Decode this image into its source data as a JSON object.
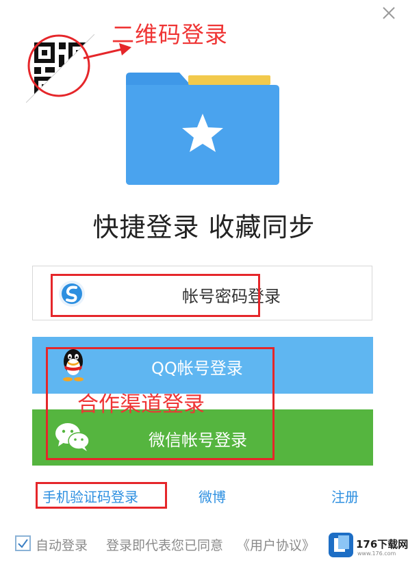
{
  "annotations": {
    "qr_login": "二维码登录",
    "partner_login": "合作渠道登录"
  },
  "slogan": "快捷登录 收藏同步",
  "buttons": {
    "account_login": "帐号密码登录",
    "qq_login": "QQ帐号登录",
    "wechat_login": "微信帐号登录"
  },
  "links": {
    "phone_login": "手机验证码登录",
    "weibo": "微博",
    "register": "注册"
  },
  "footer": {
    "auto_login": "自动登录",
    "agree_text": "登录即代表您已同意",
    "user_agreement": "《用户协议》",
    "auto_login_checked": true
  },
  "watermark": {
    "brand": "176下载网",
    "url": "www.176.com"
  },
  "colors": {
    "accent_blue": "#5fb6f1",
    "wechat_green": "#55b53f",
    "link_blue": "#2d8fe0",
    "annotation_red": "#e5262a",
    "folder_blue": "#4aa3ee"
  }
}
